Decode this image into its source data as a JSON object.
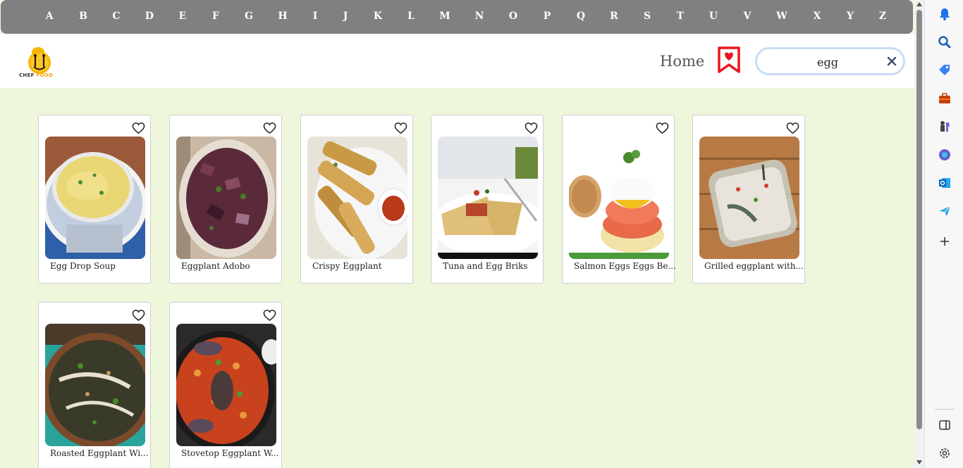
{
  "alphabet": [
    "A",
    "B",
    "C",
    "D",
    "E",
    "F",
    "G",
    "H",
    "I",
    "J",
    "K",
    "L",
    "M",
    "N",
    "O",
    "P",
    "Q",
    "R",
    "S",
    "T",
    "U",
    "V",
    "W",
    "X",
    "Y",
    "Z"
  ],
  "header": {
    "logo_text_1": "CHEF",
    "logo_text_2": "FOOD",
    "home_label": "Home"
  },
  "search": {
    "value": "egg",
    "placeholder": ""
  },
  "recipes": [
    {
      "title": "Egg Drop Soup"
    },
    {
      "title": "Eggplant Adobo"
    },
    {
      "title": "Crispy Eggplant"
    },
    {
      "title": "Tuna and Egg Briks"
    },
    {
      "title": "Salmon Eggs Eggs Be..."
    },
    {
      "title": "Grilled eggplant with..."
    },
    {
      "title": "Roasted Eggplant Wi..."
    },
    {
      "title": "Stovetop Eggplant W..."
    }
  ],
  "colors": {
    "alphabet_bar": "#808080",
    "page_background": "#eef6dc",
    "bookmark_red": "#e8161c",
    "search_border": "#c9dcf5"
  },
  "sidebar_icons": [
    "bell-icon",
    "search-icon",
    "tag-icon",
    "briefcase-icon",
    "chess-icon",
    "copilot-icon",
    "outlook-icon",
    "send-icon",
    "add-icon",
    "split-screen-icon",
    "settings-icon"
  ]
}
